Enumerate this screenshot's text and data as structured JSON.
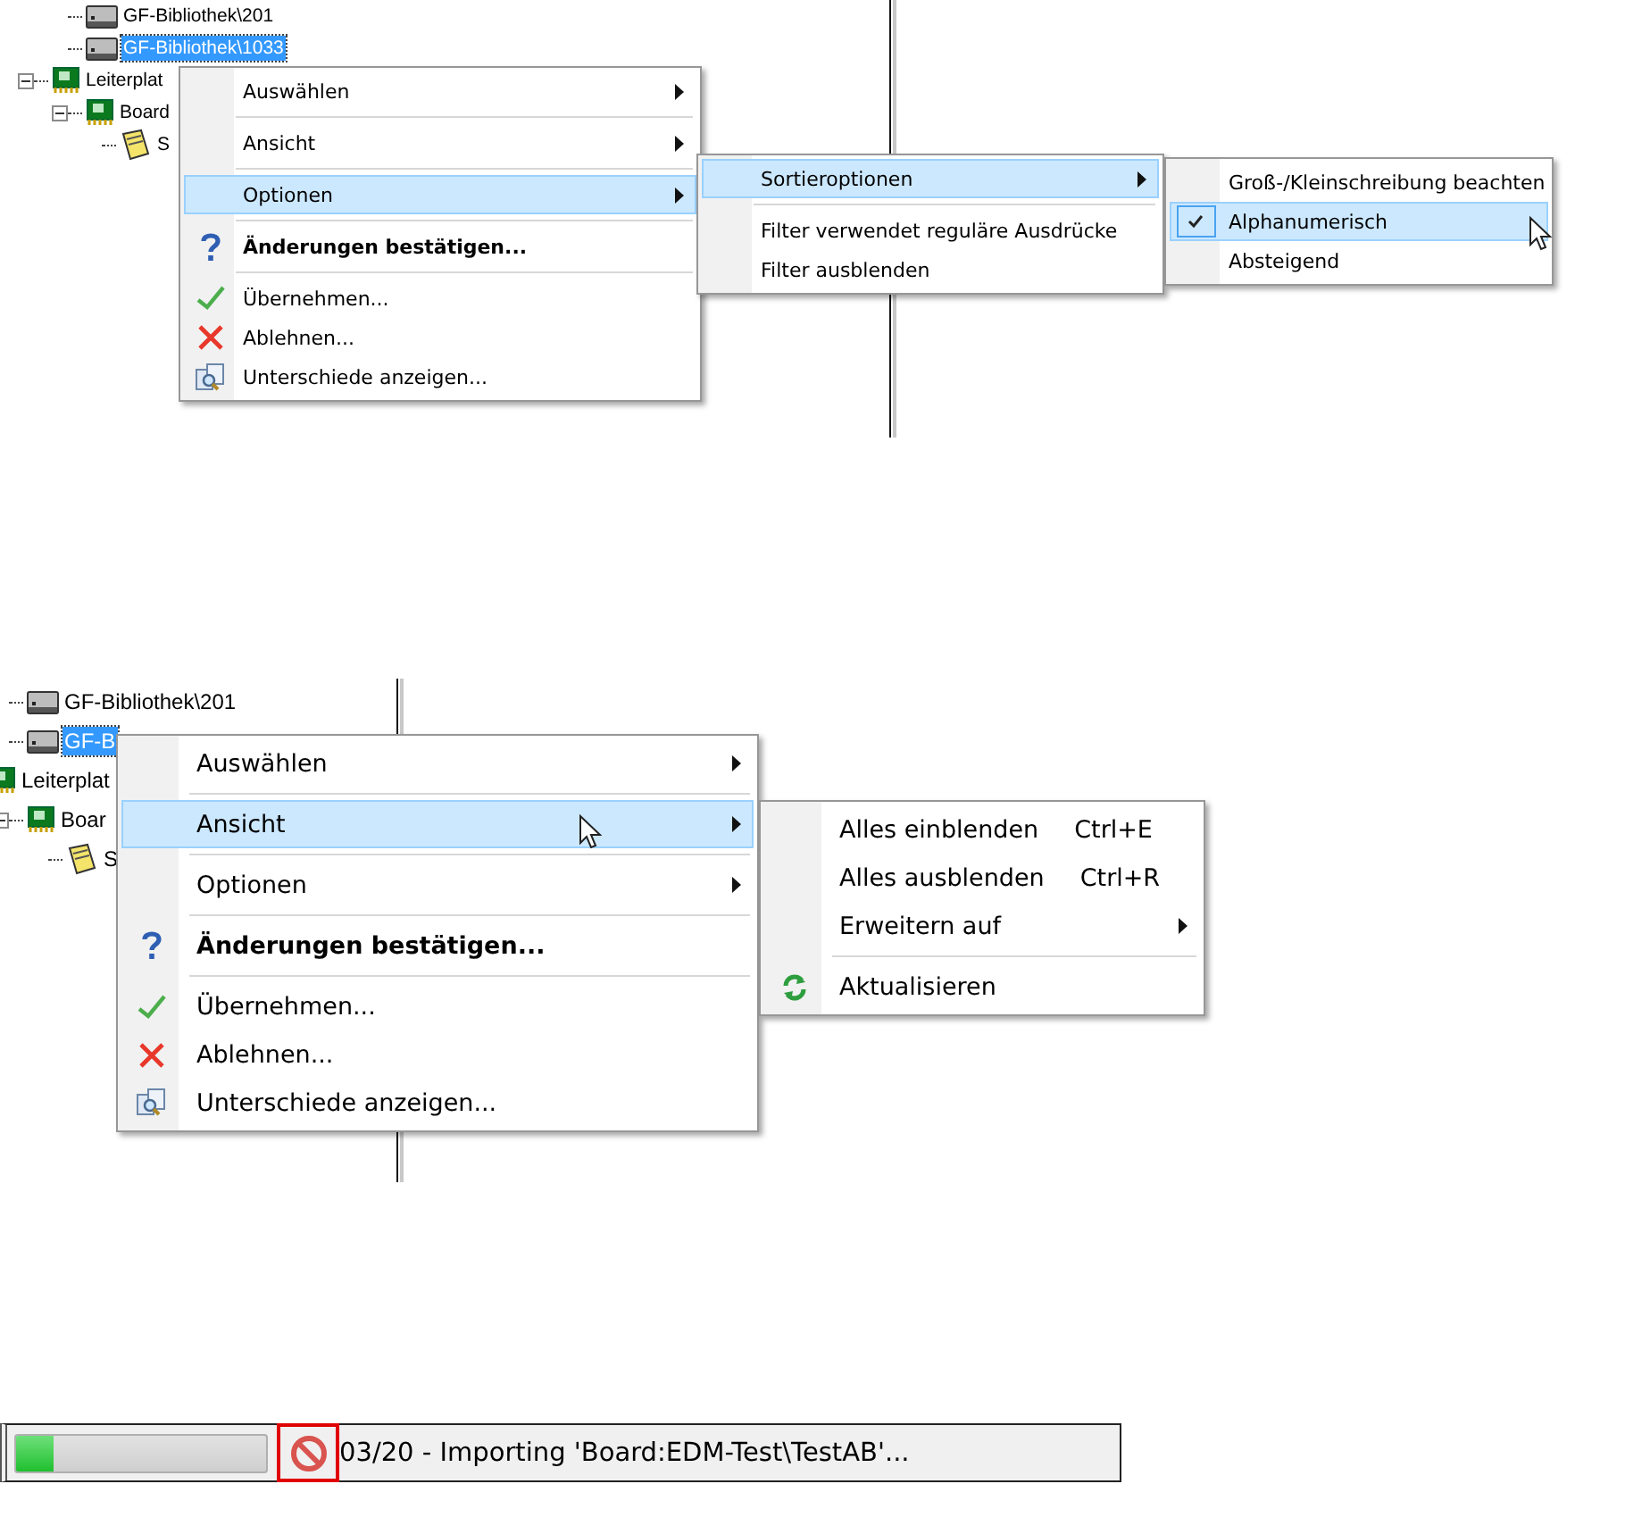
{
  "panels": [
    {
      "tree": [
        {
          "label": "GF-Bibliothek\\201",
          "kind": "chip",
          "selected": false,
          "expanded": false
        },
        {
          "label": "GF-Bibliothek\\1033",
          "kind": "chip",
          "selected": true,
          "expanded": false
        },
        {
          "label": "Leiterplat",
          "kind": "board",
          "selected": false,
          "expanded": true,
          "children": [
            {
              "label": "Board",
              "kind": "board",
              "selected": false,
              "expanded": true,
              "children": [
                {
                  "label": "S",
                  "kind": "sheet",
                  "selected": false,
                  "expanded": false
                }
              ]
            }
          ]
        }
      ],
      "menus": [
        {
          "items": [
            {
              "label": "Auswählen",
              "kind": "submenu",
              "selected": false
            },
            {
              "kind": "separator"
            },
            {
              "label": "Ansicht",
              "kind": "submenu",
              "selected": false
            },
            {
              "kind": "separator"
            },
            {
              "label": "Optionen",
              "kind": "submenu",
              "selected": true
            },
            {
              "kind": "separator"
            },
            {
              "label": "Änderungen bestätigen...",
              "kind": "help",
              "selected": false,
              "bold": true
            },
            {
              "kind": "separator"
            },
            {
              "label": "Übernehmen...",
              "kind": "accept",
              "selected": false
            },
            {
              "label": "Ablehnen...",
              "kind": "reject",
              "selected": false
            },
            {
              "label": "Unterschiede anzeigen...",
              "kind": "compare",
              "selected": false
            }
          ]
        },
        {
          "items": [
            {
              "label": "Sortieroptionen",
              "kind": "submenu",
              "selected": true
            },
            {
              "kind": "separator"
            },
            {
              "label": "Filter verwendet reguläre Ausdrücke",
              "kind": "plain",
              "selected": false
            },
            {
              "label": "Filter ausblenden",
              "kind": "plain",
              "selected": false
            }
          ]
        },
        {
          "items": [
            {
              "label": "Groß-/Kleinschreibung beachten",
              "kind": "plain",
              "selected": false,
              "checked": false
            },
            {
              "label": "Alphanumerisch",
              "kind": "plain",
              "selected": true,
              "checked": true
            },
            {
              "label": "Absteigend",
              "kind": "plain",
              "selected": false,
              "checked": false
            }
          ]
        }
      ]
    },
    {
      "tree": [
        {
          "label": "GF-Bibliothek\\201",
          "kind": "chip",
          "selected": false,
          "expanded": false
        },
        {
          "label": "GF-B",
          "kind": "chip",
          "selected": true,
          "expanded": false
        },
        {
          "label": "Leiterplat",
          "kind": "board",
          "selected": false,
          "children": [
            {
              "label": "Boar",
              "kind": "board",
              "selected": false,
              "expanded": true,
              "children": [
                {
                  "label": "S",
                  "kind": "sheet",
                  "selected": false,
                  "expanded": false
                }
              ]
            }
          ]
        }
      ],
      "menus": [
        {
          "items": [
            {
              "label": "Auswählen",
              "kind": "submenu",
              "selected": false
            },
            {
              "kind": "separator"
            },
            {
              "label": "Ansicht",
              "kind": "submenu",
              "selected": true
            },
            {
              "kind": "separator"
            },
            {
              "label": "Optionen",
              "kind": "submenu",
              "selected": false
            },
            {
              "kind": "separator"
            },
            {
              "label": "Änderungen bestätigen...",
              "kind": "help",
              "selected": false,
              "bold": true
            },
            {
              "kind": "separator"
            },
            {
              "label": "Übernehmen...",
              "kind": "accept",
              "selected": false
            },
            {
              "label": "Ablehnen...",
              "kind": "reject",
              "selected": false
            },
            {
              "label": "Unterschiede anzeigen...",
              "kind": "compare",
              "selected": false
            }
          ]
        },
        {
          "items": [
            {
              "label": "Alles einblenden",
              "kind": "plain",
              "selected": false,
              "shortcut": "Ctrl+E"
            },
            {
              "label": "Alles ausblenden",
              "kind": "plain",
              "selected": false,
              "shortcut": "Ctrl+R"
            },
            {
              "label": "Erweitern auf",
              "kind": "submenu",
              "selected": false
            },
            {
              "kind": "separator"
            },
            {
              "label": "Aktualisieren",
              "kind": "refresh",
              "selected": false
            }
          ]
        }
      ]
    }
  ],
  "status_bar": {
    "progress": {
      "level": 0.15
    },
    "cancel_button": {
      "highlighted": true
    },
    "message": "03/20 - Importing 'Board:EDM-Test\\TestAB'..."
  }
}
